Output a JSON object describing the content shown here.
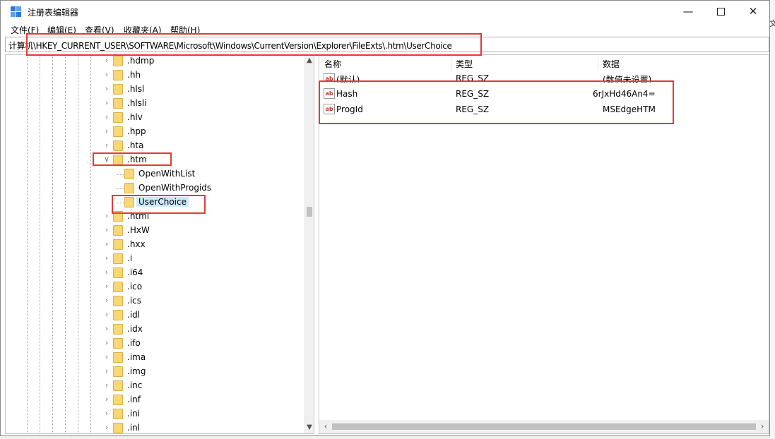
{
  "window": {
    "title": "注册表编辑器"
  },
  "menu": [
    "文件(F)",
    "编辑(E)",
    "查看(V)",
    "收藏夹(A)",
    "帮助(H)"
  ],
  "address": "计算机\\HKEY_CURRENT_USER\\SOFTWARE\\Microsoft\\Windows\\CurrentVersion\\Explorer\\FileExts\\.htm\\UserChoice",
  "tree": {
    "items_before": [
      ".hdmp",
      ".hh",
      ".hlsl",
      ".hlsli",
      ".hlv",
      ".hpp",
      ".hta"
    ],
    "expanded": ".htm",
    "children": [
      "OpenWithList",
      "OpenWithProgids",
      "UserChoice"
    ],
    "selected_child": "UserChoice",
    "items_after": [
      ".html",
      ".HxW",
      ".hxx",
      ".i",
      ".i64",
      ".ico",
      ".ics",
      ".idl",
      ".idx",
      ".ifo",
      ".ima",
      ".img",
      ".inc",
      ".inf",
      ".ini",
      ".inl"
    ]
  },
  "list": {
    "headers": [
      "名称",
      "类型",
      "数据"
    ],
    "rows": [
      {
        "name": "(默认)",
        "type": "REG_SZ",
        "data": "(数值未设置)"
      },
      {
        "name": "Hash",
        "type": "REG_SZ",
        "data": "6rJxHd46An4="
      },
      {
        "name": "ProgId",
        "type": "REG_SZ",
        "data": "MSEdgeHTM"
      }
    ]
  },
  "side_fragment": "文",
  "colors": {
    "highlight": "#e53935",
    "selection": "#cce8ff",
    "folder": "#f8d774"
  }
}
